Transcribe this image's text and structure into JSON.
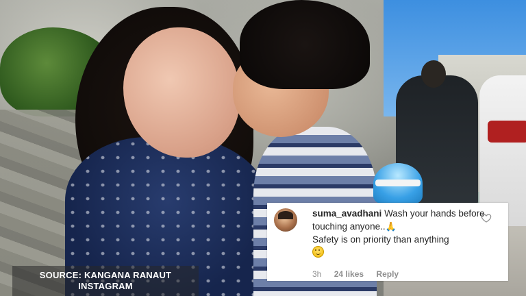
{
  "caption": {
    "line1": "SOURCE: KANGANA RANAUT",
    "line2": "INSTAGRAM"
  },
  "comment": {
    "username": "suma_avadhani",
    "text_part1": "Wash your hands before touching anyone..",
    "emoji1": "🙏",
    "text_part2": "Safety is on priority than anything",
    "emoji2": "smiling-face-emoji",
    "time": "3h",
    "likes": "24 likes",
    "reply": "Reply",
    "heart_icon": "heart-outline-icon"
  },
  "colors": {
    "comment_text": "#262626",
    "meta_text": "#8e8e8e",
    "caption_bg": "rgba(40,40,40,0.55)"
  }
}
